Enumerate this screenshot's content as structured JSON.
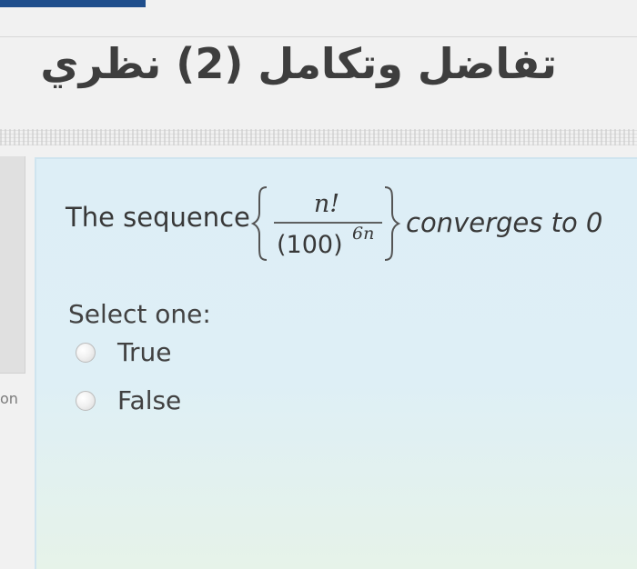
{
  "page": {
    "title": "تفاضل وتكامل (2) نظري"
  },
  "side": {
    "fragment": "on"
  },
  "question": {
    "prefix": "The sequence",
    "numerator": "n!",
    "denominator_base": "(100)",
    "denominator_exponent": "6n",
    "suffix": "converges to 0",
    "select_label": "Select one:",
    "options": [
      {
        "label": "True"
      },
      {
        "label": "False"
      }
    ]
  },
  "colors": {
    "title": "#3e3e3e",
    "panel": "#ddeef6",
    "text": "#383838",
    "dark_strip": "#1f4e8c"
  }
}
